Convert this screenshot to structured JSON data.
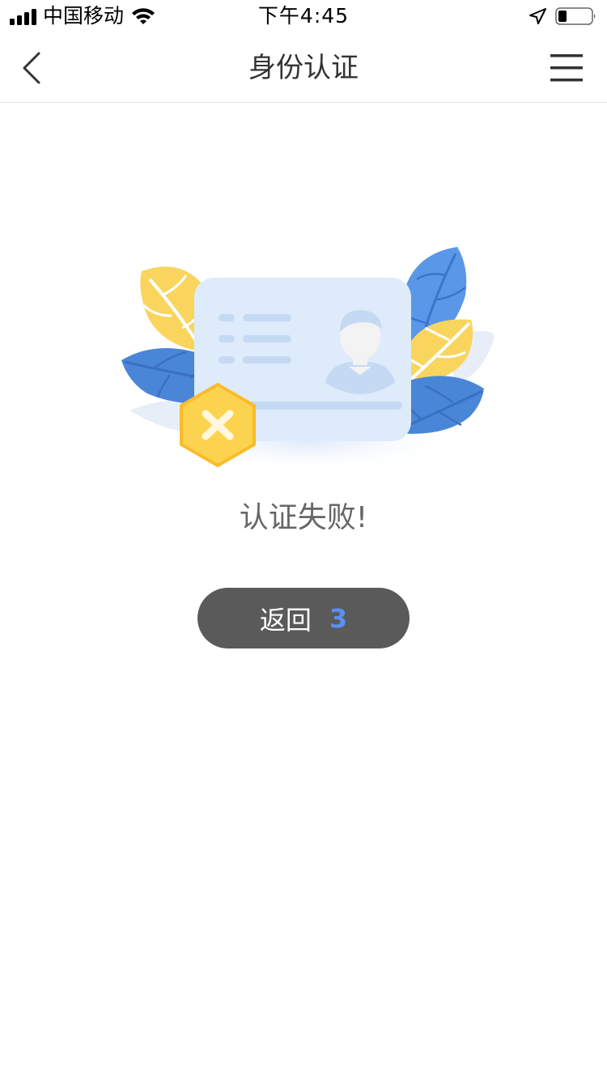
{
  "status_bar": {
    "carrier": "中国移动",
    "time": "下午4:45",
    "icons": [
      "signal-icon",
      "wifi-icon",
      "location-icon",
      "battery-icon"
    ],
    "battery_level": 0.25
  },
  "nav": {
    "title": "身份认证",
    "back_icon": "chevron-left-icon",
    "menu_icon": "hamburger-menu-icon"
  },
  "illustration": {
    "icon": "id-card-icon",
    "badge_icon": "close-icon",
    "colors": {
      "card": "#deebfb",
      "blue_leaf": "#4a86d8",
      "yellow_leaf": "#f9d55e",
      "badge": "#fbc63a"
    }
  },
  "result": {
    "message": "认证失败!"
  },
  "back_button": {
    "label": "返回",
    "countdown": "3",
    "colors": {
      "background": "#5a5a5a",
      "countdown": "#5b8ff0"
    }
  }
}
